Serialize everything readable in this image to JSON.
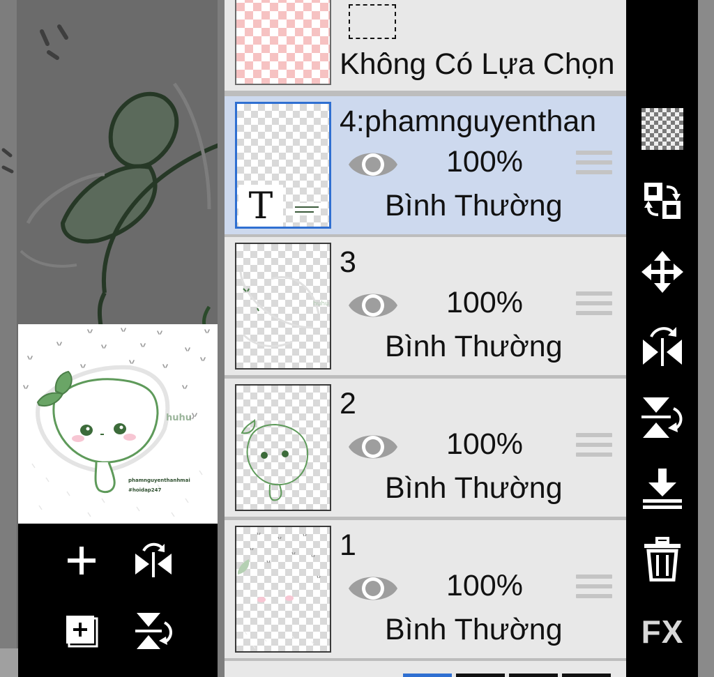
{
  "selection": {
    "label": "Không Có Lựa Chọn"
  },
  "layers": [
    {
      "name": "4:phamnguyenthan",
      "opacity": "100%",
      "blend": "Bình Thường",
      "selected": true,
      "thumb_letter": "T"
    },
    {
      "name": "3",
      "opacity": "100%",
      "blend": "Bình Thường",
      "selected": false
    },
    {
      "name": "2",
      "opacity": "100%",
      "blend": "Bình Thường",
      "selected": false
    },
    {
      "name": "1",
      "opacity": "100%",
      "blend": "Bình Thường",
      "selected": false
    }
  ],
  "preview": {
    "sticker_text": "huhu",
    "caption_line1": "phamnguyenthanhmai",
    "caption_line2": "#hoidap247"
  },
  "layer3_thumb_text": "huhu",
  "toolbar": {
    "fx_label": "FX"
  },
  "icons": {
    "transparency": "checker-icon",
    "swap": "swap-layer-icon",
    "move": "move-icon",
    "flip_h": "flip-horizontal-icon",
    "flip_v": "flip-vertical-icon",
    "merge_down": "merge-down-icon",
    "delete": "trash-icon",
    "add": "plus-icon",
    "add_layer": "add-layer-icon"
  },
  "colors": {
    "selected_row": "#cdd9ee",
    "row": "#e8e8e8",
    "selected_border": "#2f6fd1",
    "sticker_green": "#5e9a5a"
  }
}
